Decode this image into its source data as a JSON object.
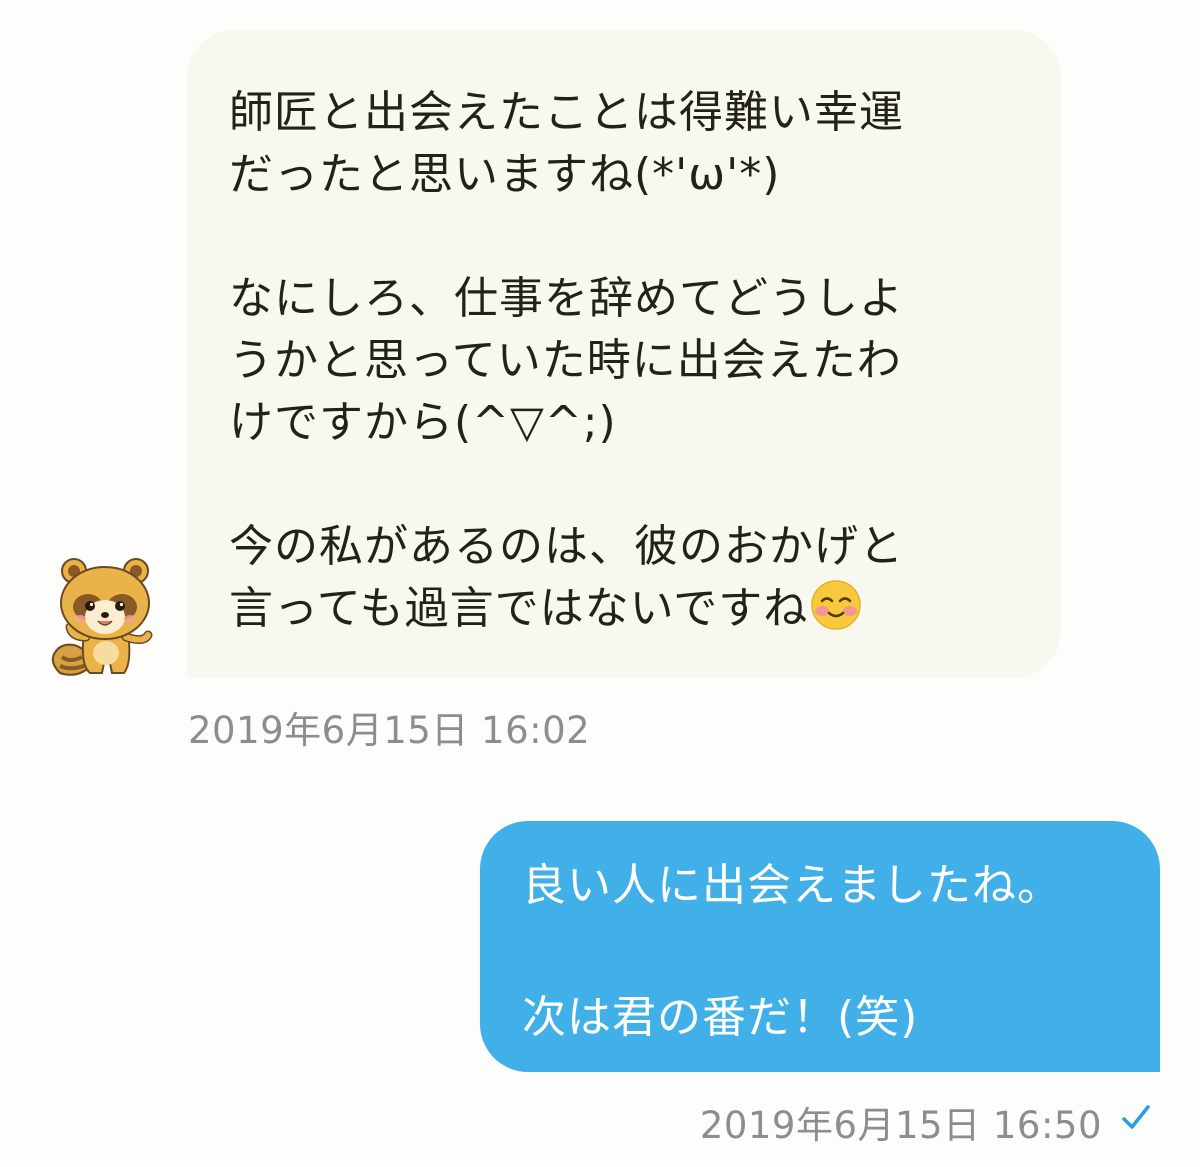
{
  "incoming": {
    "lines_1": [
      "師匠と出会えたことは得難い幸運",
      "だったと思いますね(*'ω'*)"
    ],
    "lines_2": [
      "なにしろ、仕事を辞めてどうしよ",
      "うかと思っていた時に出会えたわ",
      "けですから(^▽^;)"
    ],
    "lines_3": [
      "今の私があるのは、彼のおかげと",
      "言っても過言ではないですね"
    ],
    "emoji": "smiling-face-emoji",
    "avatar": "tanuki-avatar",
    "timestamp": "2019年6月15日 16:02"
  },
  "outgoing": {
    "line_1": "良い人に出会えましたね。",
    "line_2": "次は君の番だ！(笑)",
    "timestamp": "2019年6月15日 16:50",
    "status_icon": "check-icon"
  },
  "colors": {
    "incoming_bubble": "#f7f8ef",
    "outgoing_bubble": "#42b0e8",
    "timestamp": "#8a8e90",
    "check": "#2e9ee0"
  }
}
